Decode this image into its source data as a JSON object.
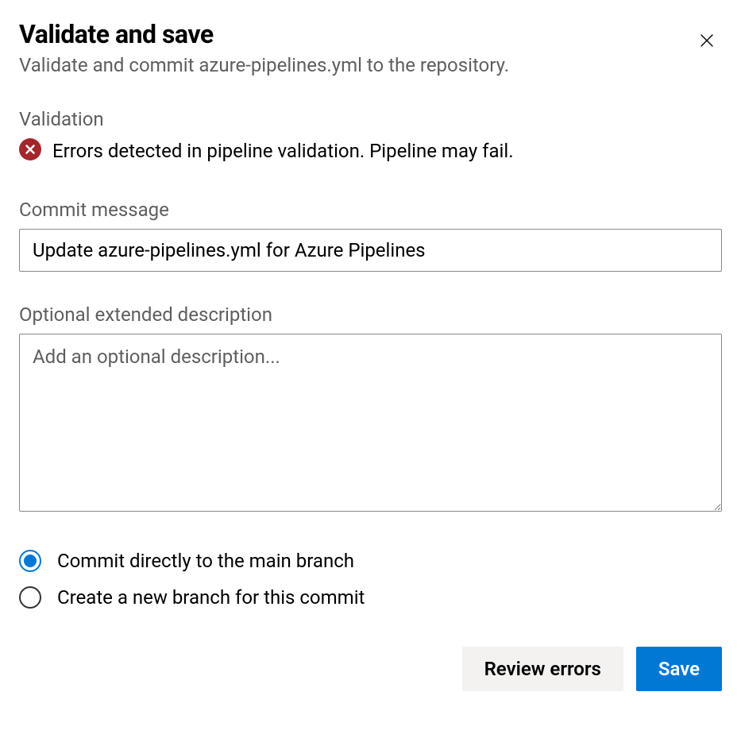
{
  "dialog": {
    "title": "Validate and save",
    "subtitle": "Validate and commit azure-pipelines.yml to the repository."
  },
  "validation": {
    "label": "Validation",
    "message": "Errors detected in pipeline validation. Pipeline may fail."
  },
  "commit_message": {
    "label": "Commit message",
    "value": "Update azure-pipelines.yml for Azure Pipelines"
  },
  "description": {
    "label": "Optional extended description",
    "placeholder": "Add an optional description...",
    "value": ""
  },
  "branch_options": {
    "commit_direct": "Commit directly to the main branch",
    "create_new": "Create a new branch for this commit",
    "selected": "commit_direct"
  },
  "buttons": {
    "review": "Review errors",
    "save": "Save"
  },
  "colors": {
    "primary": "#0078d4",
    "error": "#a4262c"
  }
}
